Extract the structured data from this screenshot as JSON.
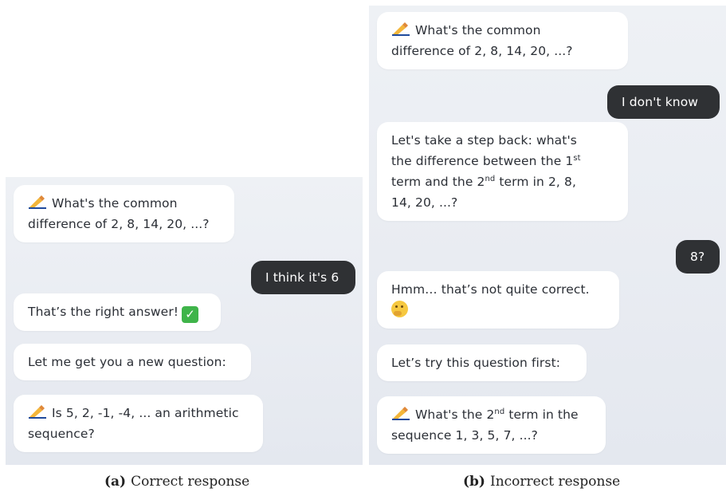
{
  "panel_a": {
    "messages": [
      {
        "role": "bot",
        "icon": "writing-hand-emoji",
        "line1": "What's the common",
        "line2": "difference of 2, 8, 14, 20, ...?"
      },
      {
        "role": "user",
        "text": "I think it's 6"
      },
      {
        "role": "bot",
        "text": "That’s the right answer!",
        "icon": "check-mark-emoji"
      },
      {
        "role": "bot",
        "text": "Let me get you a new question:"
      },
      {
        "role": "bot",
        "icon": "writing-hand-emoji",
        "line1": "Is 5, 2, -1, -4, ... an arithmetic",
        "line2": "sequence?"
      }
    ],
    "caption_label": "(a)",
    "caption_text": "Correct response"
  },
  "panel_b": {
    "messages": [
      {
        "role": "bot",
        "icon": "writing-hand-emoji",
        "line1": "What's the common",
        "line2": "difference of 2, 8, 14, 20, ...?"
      },
      {
        "role": "user",
        "text": "I don't know"
      },
      {
        "role": "bot",
        "l1": "Let's take a step back: what's",
        "l2a": "the difference between the 1",
        "l2sup": "st",
        "l3a": "term and the 2",
        "l3sup": "nd",
        "l3b": " term in 2, 8,",
        "l4": "14, 20, ...?"
      },
      {
        "role": "user",
        "text": "8?"
      },
      {
        "role": "bot",
        "line1": "Hmm… that’s not quite correct.",
        "icon": "thinking-face-emoji"
      },
      {
        "role": "bot",
        "text": "Let’s try this question first:"
      },
      {
        "role": "bot",
        "icon": "writing-hand-emoji",
        "l1a": "What's the 2",
        "l1sup": "nd",
        "l1b": " term in the",
        "line2": "sequence 1, 3, 5, 7, ...?"
      }
    ],
    "caption_label": "(b)",
    "caption_text": "Incorrect response"
  }
}
